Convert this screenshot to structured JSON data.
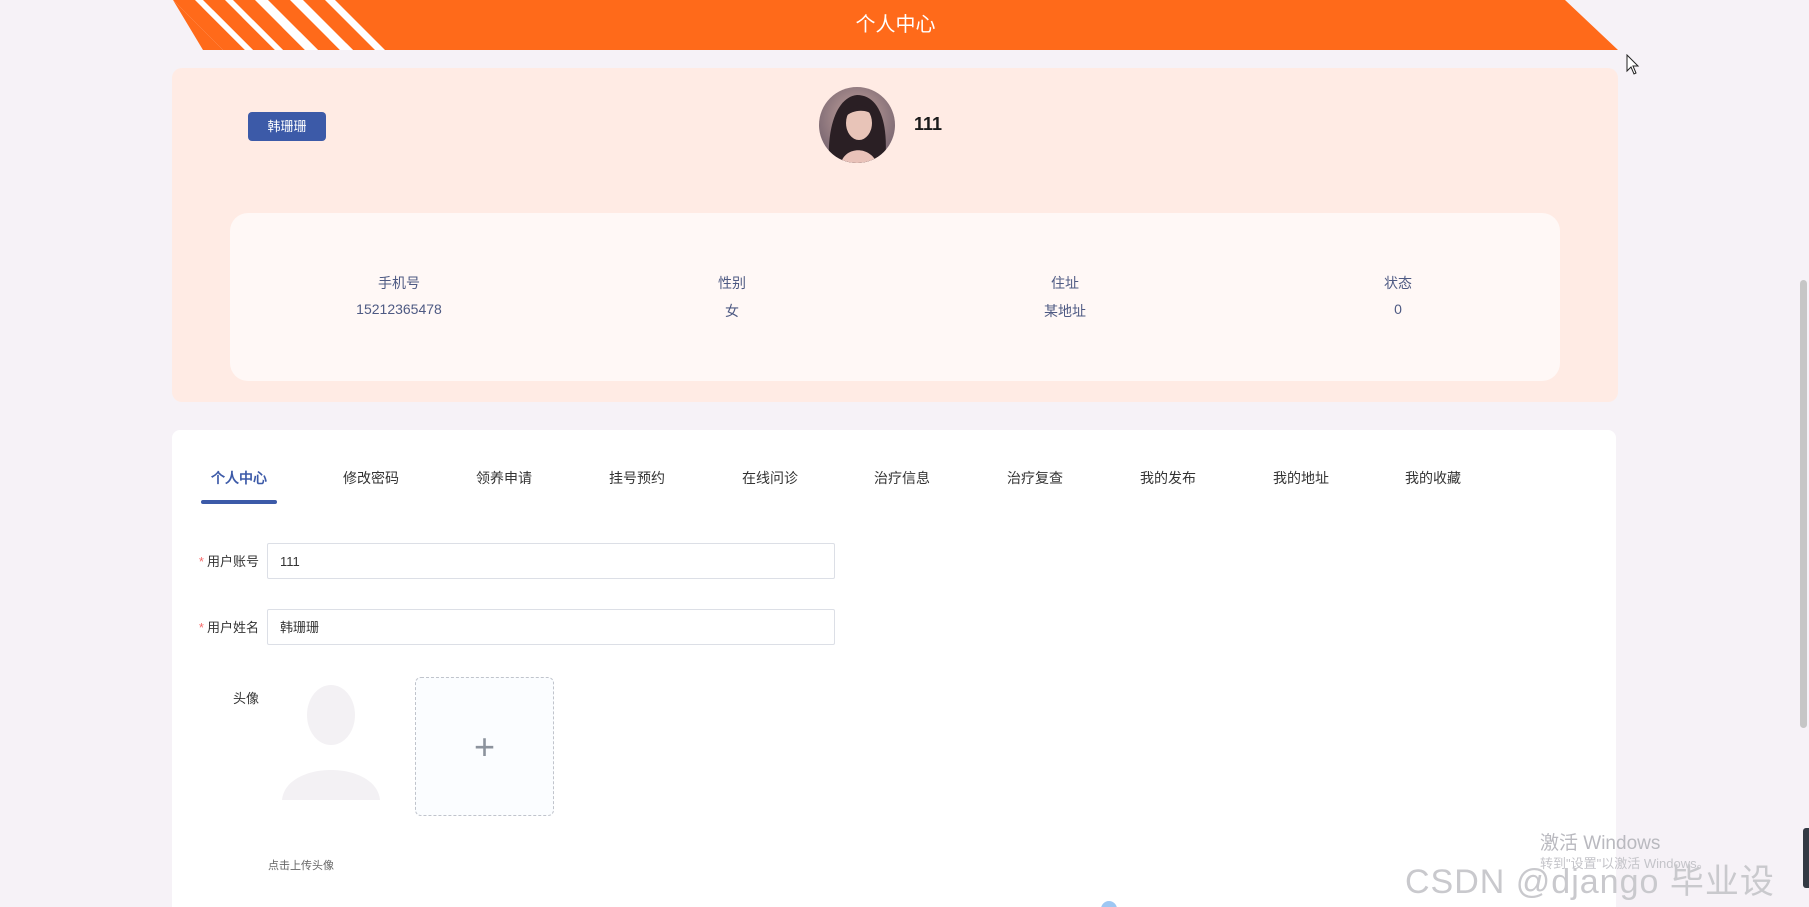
{
  "banner": {
    "title": "个人中心",
    "color": "#ff6a1a"
  },
  "profile": {
    "name_badge": "韩珊珊",
    "username": "111",
    "info": [
      {
        "label": "手机号",
        "value": "15212365478"
      },
      {
        "label": "性别",
        "value": "女"
      },
      {
        "label": "住址",
        "value": "某地址"
      },
      {
        "label": "状态",
        "value": "0"
      }
    ]
  },
  "tabs": [
    {
      "label": "个人中心",
      "active": true
    },
    {
      "label": "修改密码",
      "active": false
    },
    {
      "label": "领养申请",
      "active": false
    },
    {
      "label": "挂号预约",
      "active": false
    },
    {
      "label": "在线问诊",
      "active": false
    },
    {
      "label": "治疗信息",
      "active": false
    },
    {
      "label": "治疗复查",
      "active": false
    },
    {
      "label": "我的发布",
      "active": false
    },
    {
      "label": "我的地址",
      "active": false
    },
    {
      "label": "我的收藏",
      "active": false
    }
  ],
  "form": {
    "account_label": "用户账号",
    "account_value": "111",
    "name_label": "用户姓名",
    "name_value": "韩珊珊",
    "required_mark": "*",
    "avatar_label": "头像",
    "upload_plus": "+",
    "upload_hint": "点击上传头像"
  },
  "watermarks": {
    "windows_line1": "激活 Windows",
    "windows_line2": "转到\"设置\"以激活 Windows。",
    "csdn": "CSDN @django 毕业设计"
  },
  "colors": {
    "accent": "#3c5aa8",
    "banner": "#ff6a1a",
    "card": "#ffebe4"
  }
}
